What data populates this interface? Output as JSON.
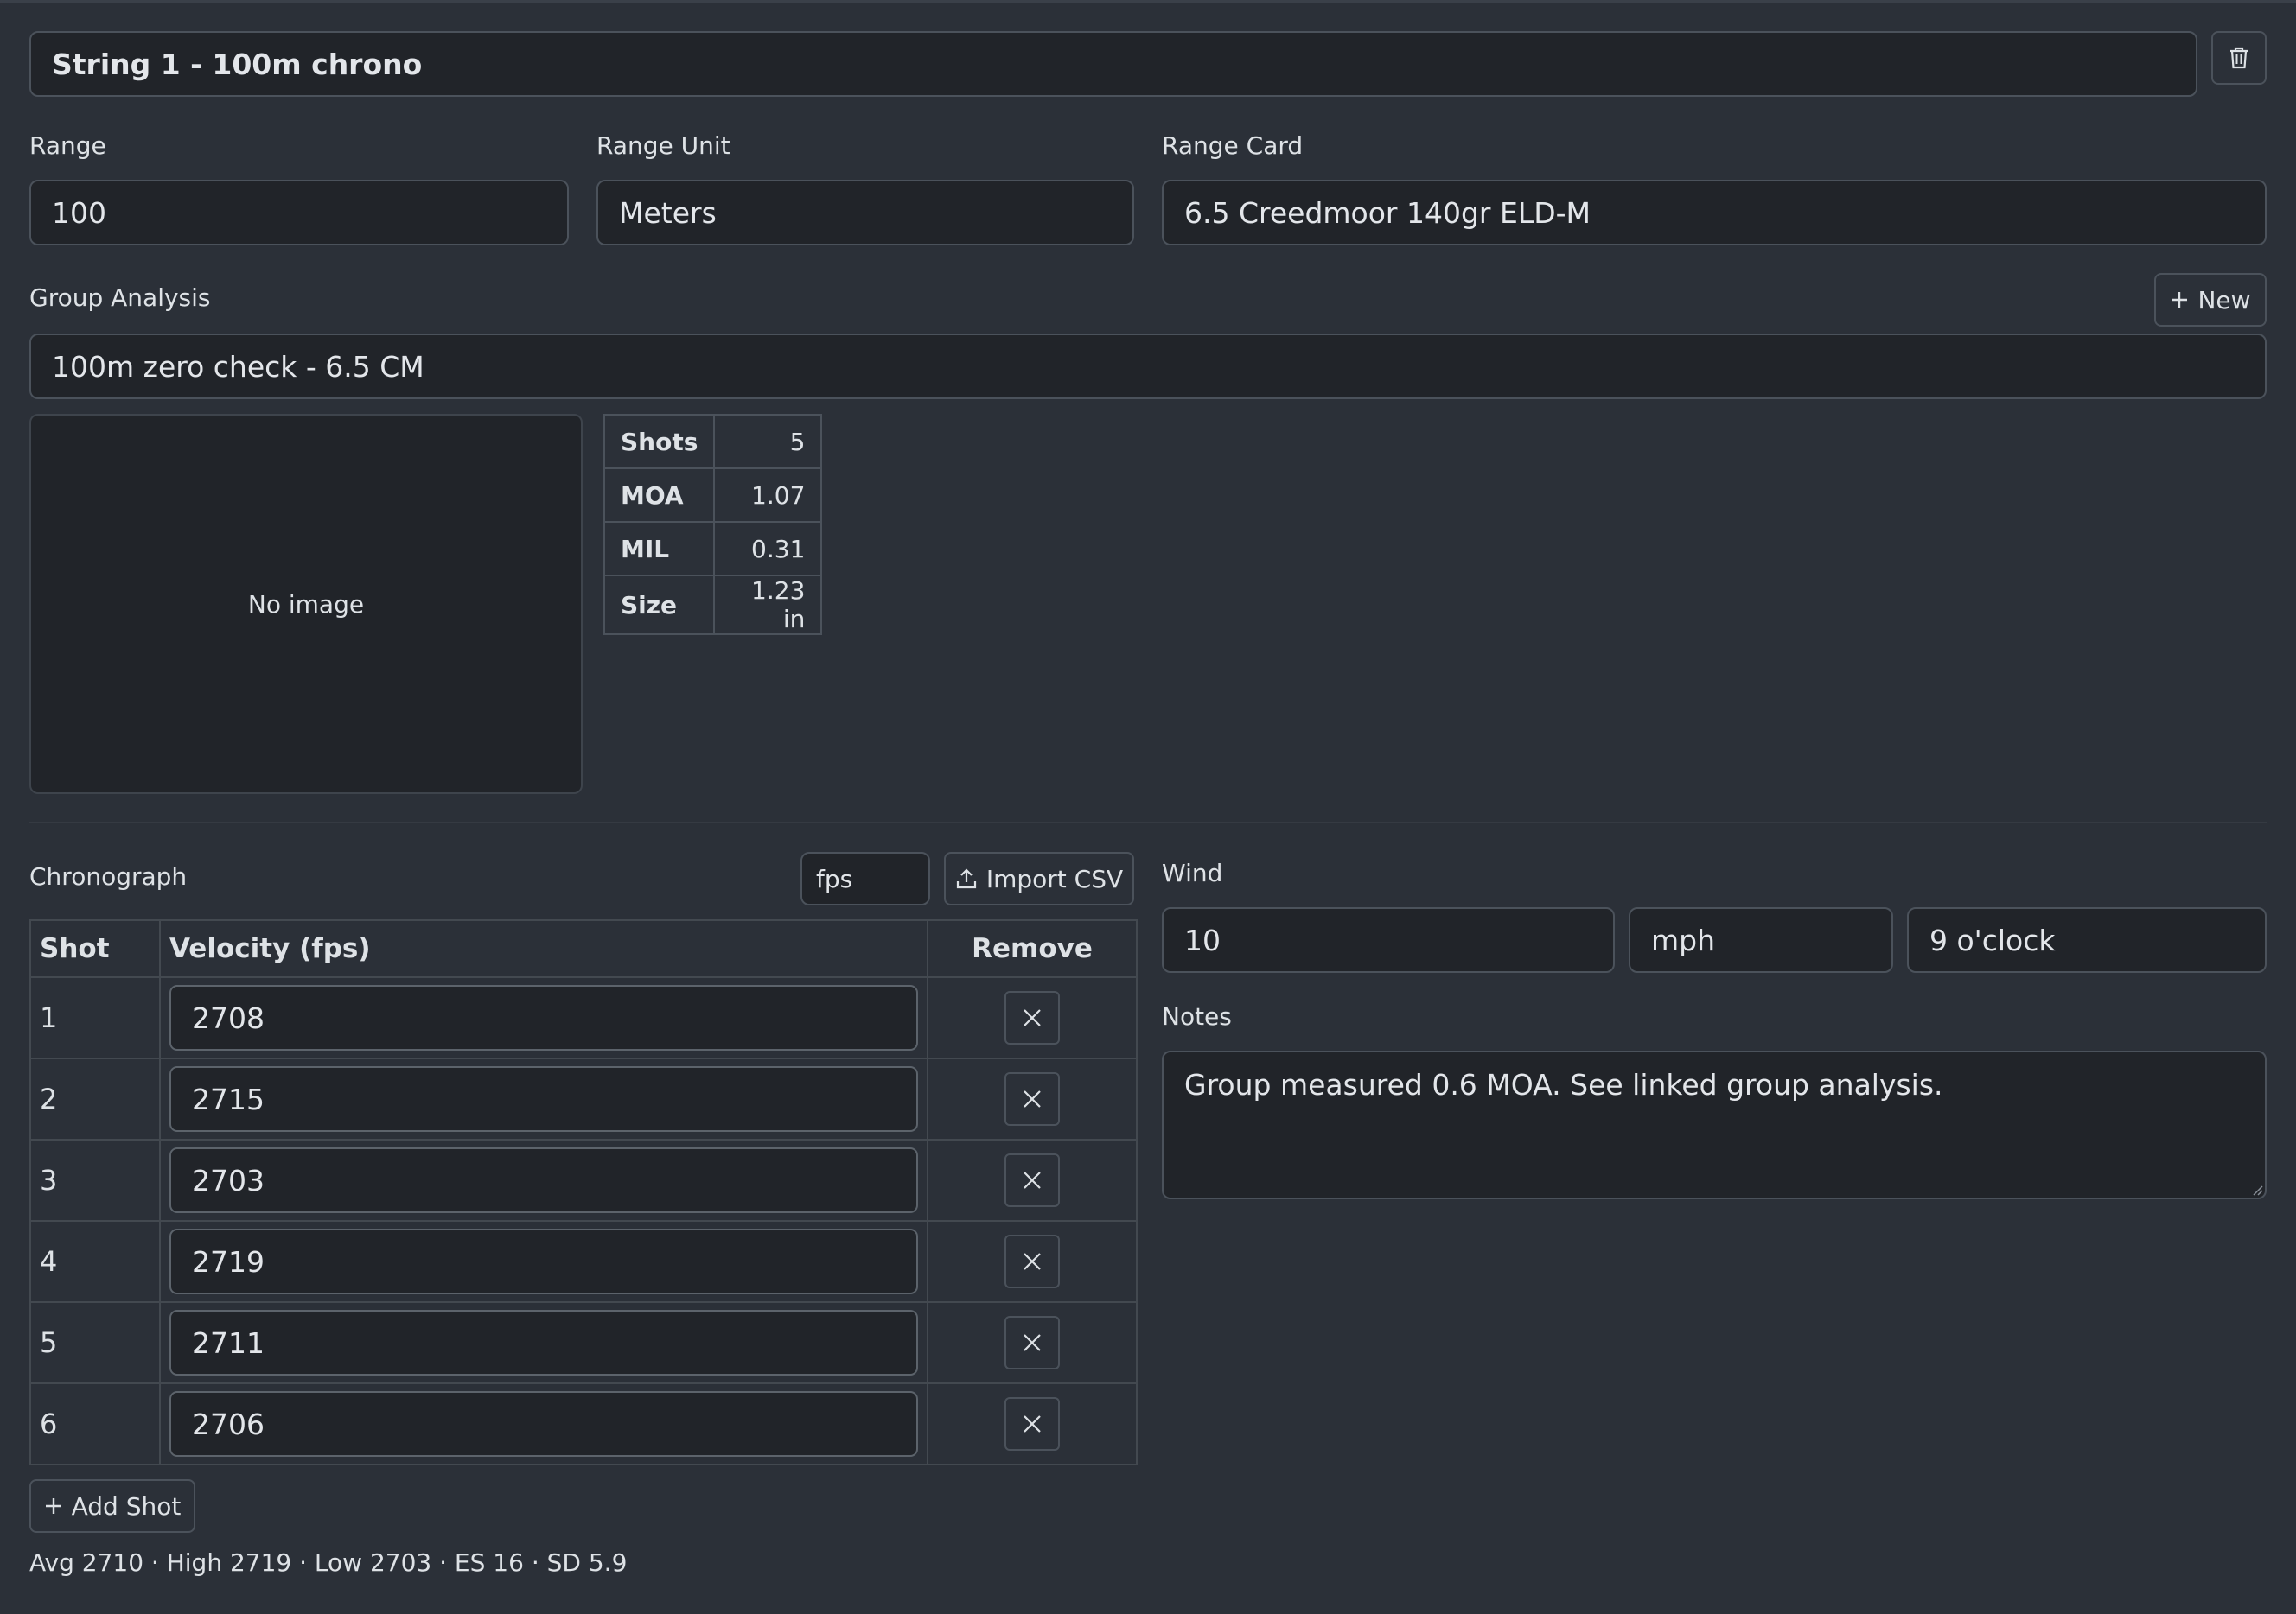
{
  "string": {
    "title": "String 1 - 100m chrono"
  },
  "range": {
    "label": "Range",
    "value": "100"
  },
  "range_unit": {
    "label": "Range Unit",
    "value": "Meters"
  },
  "range_card": {
    "label": "Range Card",
    "value": "6.5 Creedmoor 140gr ELD-M"
  },
  "group_analysis": {
    "label": "Group Analysis",
    "new_label": "New",
    "selected": "100m zero check - 6.5 CM",
    "image_placeholder": "No image",
    "stats": [
      {
        "key": "Shots",
        "value": "5"
      },
      {
        "key": "MOA",
        "value": "1.07"
      },
      {
        "key": "MIL",
        "value": "0.31"
      },
      {
        "key": "Size",
        "value": "1.23 in"
      }
    ]
  },
  "chronograph": {
    "label": "Chronograph",
    "unit": "fps",
    "import_label": "Import CSV",
    "columns": {
      "shot": "Shot",
      "velocity": "Velocity (fps)",
      "remove": "Remove"
    },
    "rows": [
      {
        "shot": "1",
        "velocity": "2708"
      },
      {
        "shot": "2",
        "velocity": "2715"
      },
      {
        "shot": "3",
        "velocity": "2703"
      },
      {
        "shot": "4",
        "velocity": "2719"
      },
      {
        "shot": "5",
        "velocity": "2711"
      },
      {
        "shot": "6",
        "velocity": "2706"
      }
    ],
    "add_shot_label": "Add Shot",
    "summary": "Avg 2710 · High 2719 · Low 2703 · ES 16 · SD 5.9"
  },
  "wind": {
    "label": "Wind",
    "speed": "10",
    "unit": "mph",
    "direction": "9 o'clock"
  },
  "notes": {
    "label": "Notes",
    "value": "Group measured 0.6 MOA. See linked group analysis."
  },
  "icons": {
    "delete": "trash-icon",
    "add": "plus-icon",
    "upload": "upload-icon",
    "remove": "close-icon"
  },
  "colors": {
    "background": "#2b3038",
    "field": "#212429",
    "border": "#4b525b",
    "text": "#dee2e6"
  }
}
